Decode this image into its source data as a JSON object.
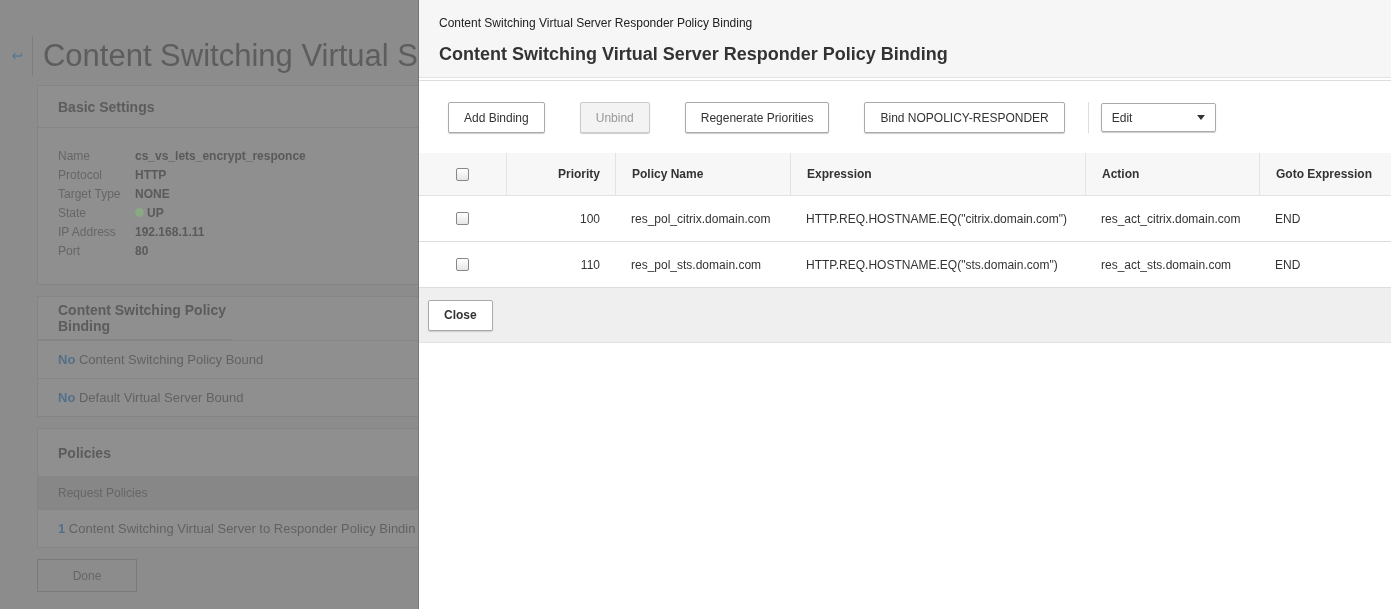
{
  "page": {
    "title": "Content Switching Virtual S",
    "basic_settings": {
      "title": "Basic Settings",
      "fields": [
        {
          "label": "Name",
          "value": "cs_vs_lets_encrypt_responce",
          "kind": "text"
        },
        {
          "label": "Protocol",
          "value": "HTTP",
          "kind": "text"
        },
        {
          "label": "Target Type",
          "value": "NONE",
          "kind": "text"
        },
        {
          "label": "State",
          "value": "UP",
          "kind": "status"
        },
        {
          "label": "IP Address",
          "value": "192.168.1.11",
          "kind": "text"
        },
        {
          "label": "Port",
          "value": "80",
          "kind": "text"
        }
      ]
    },
    "cs_policy_binding": {
      "title": "Content Switching Policy Binding",
      "rows": [
        "**No** Content Switching Policy Bound",
        "**No** Default Virtual Server Bound"
      ]
    },
    "policies": {
      "title": "Policies",
      "subheader": "Request Policies",
      "rows": [
        "**1** Content Switching Virtual Server to Responder Policy Bindin"
      ]
    },
    "done_button": "Done"
  },
  "panel": {
    "breadcrumb": "Content Switching Virtual Server Responder Policy Binding",
    "title": "Content Switching Virtual Server Responder Policy Binding",
    "toolbar": [
      {
        "label": "Add Binding",
        "disabled": false
      },
      {
        "label": "Unbind",
        "disabled": true
      },
      {
        "label": "Regenerate Priorities",
        "disabled": false
      },
      {
        "label": "Bind NOPOLICY-RESPONDER",
        "disabled": false
      }
    ],
    "dropdown": {
      "value": "Edit"
    },
    "table": {
      "select_all_checked": false,
      "columns": [
        "Priority",
        "Policy Name",
        "Expression",
        "Action",
        "Goto Expression"
      ],
      "rows": [
        {
          "checked": false,
          "cells": [
            "100",
            "res_pol_citrix.domain.com",
            "HTTP.REQ.HOSTNAME.EQ(\"citrix.domain.com\")",
            "res_act_citrix.domain.com",
            "END"
          ]
        },
        {
          "checked": false,
          "cells": [
            "110",
            "res_pol_sts.domain.com",
            "HTTP.REQ.HOSTNAME.EQ(\"sts.domain.com\")",
            "res_act_sts.domain.com",
            "END"
          ]
        }
      ]
    },
    "close_button": "Close"
  }
}
